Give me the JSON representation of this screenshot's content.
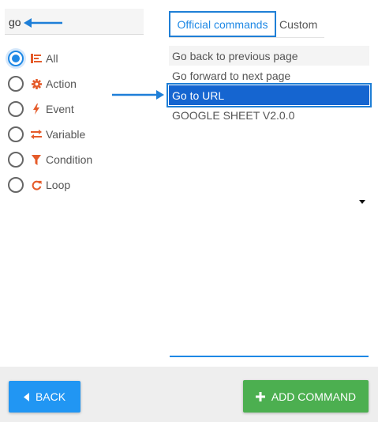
{
  "search": {
    "value": "go"
  },
  "filters": {
    "selected": "All",
    "items": [
      {
        "label": "All",
        "icon": "list-icon",
        "checked": true
      },
      {
        "label": "Action",
        "icon": "gear-icon",
        "checked": false
      },
      {
        "label": "Event",
        "icon": "lightning-icon",
        "checked": false
      },
      {
        "label": "Variable",
        "icon": "exchange-icon",
        "checked": false
      },
      {
        "label": "Condition",
        "icon": "funnel-icon",
        "checked": false
      },
      {
        "label": "Loop",
        "icon": "refresh-icon",
        "checked": false
      }
    ]
  },
  "tabs": {
    "official": "Official commands",
    "custom": "Custom",
    "active": "official"
  },
  "commands": [
    {
      "label": "Go back to previous page",
      "state": "hover"
    },
    {
      "label": "Go forward to next page",
      "state": "normal"
    },
    {
      "label": "Go to URL",
      "state": "selected"
    },
    {
      "label": "GOOGLE SHEET V2.0.0",
      "state": "normal"
    }
  ],
  "footer": {
    "back_label": "BACK",
    "add_label": "ADD COMMAND"
  },
  "colors": {
    "accent": "#1e88e5",
    "selected_bg": "#1565d0",
    "icon_orange": "#e55b2a",
    "back_button": "#2196f3",
    "add_button": "#4caf50"
  }
}
